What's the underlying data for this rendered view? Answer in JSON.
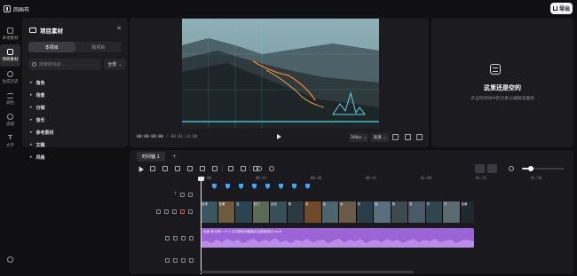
{
  "topbar": {
    "back_label": "回画布",
    "export_label": "导出"
  },
  "leftnav": {
    "items": [
      {
        "label": "本地素材",
        "icon": "local-material-icon"
      },
      {
        "label": "项目素材",
        "icon": "project-material-icon",
        "active": true
      },
      {
        "label": "生成历史",
        "icon": "history-icon"
      },
      {
        "label": "调色",
        "icon": "color-icon"
      },
      {
        "label": "滤镜",
        "icon": "filter-icon"
      },
      {
        "label": "文字",
        "icon": "text-icon"
      }
    ]
  },
  "material_panel": {
    "title": "项目素材",
    "tabs": [
      "本项目",
      "跨项目"
    ],
    "search_placeholder": "搜索剧情素...",
    "filter_label": "全部",
    "categories": [
      "角色",
      "场景",
      "分镜",
      "音乐",
      "参考素材",
      "文稿",
      "风格"
    ]
  },
  "preview": {
    "current_time": "00:00:00:00",
    "total_time": "00:01:14:08",
    "fps": "30fps",
    "quality": "高清"
  },
  "properties": {
    "empty_title": "这里还是空的",
    "empty_sub": "点击时间线中的元素以编辑其属性"
  },
  "timeline": {
    "tab": "时间轴 1",
    "ruler": [
      "00:00",
      "00:15",
      "00:30",
      "00:45",
      "01:00",
      "01:15",
      "01:30"
    ],
    "clips": [
      "石来",
      "在黄",
      "当",
      "石门",
      "丝全",
      "荡",
      "苏",
      "远",
      "水",
      "光",
      "远",
      "荡",
      "苏",
      "尔",
      "方",
      "全景"
    ],
    "audio_label": "全景·音·历时一个·1·文字脚本完整版并且配音剪切.mp3"
  },
  "colors": {
    "accent": "#3aa7ff",
    "audio": "#9b63d6"
  }
}
